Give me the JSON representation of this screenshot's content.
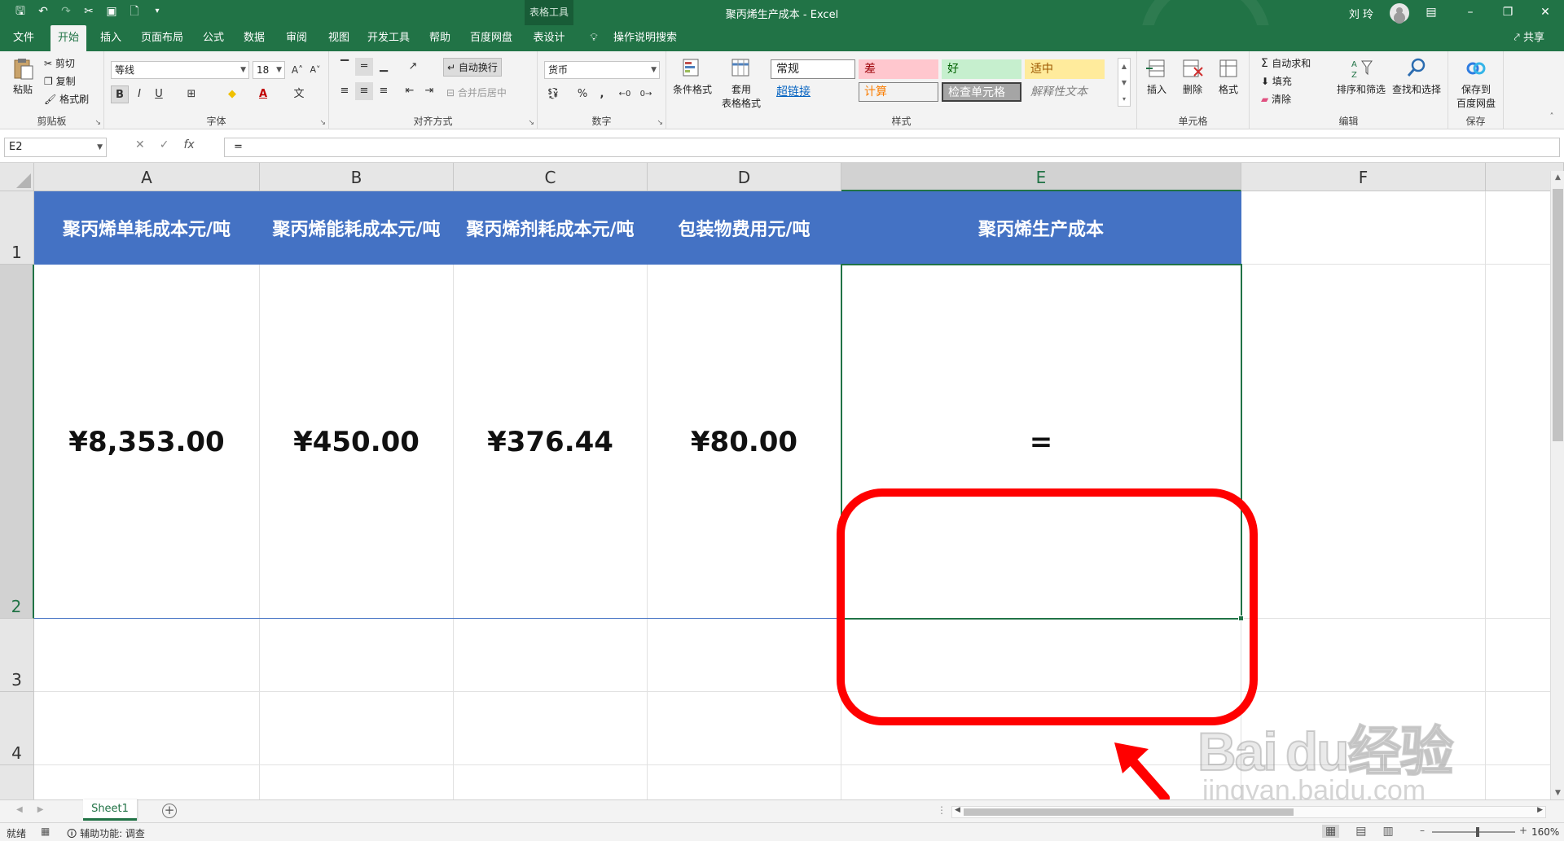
{
  "titlebar": {
    "doc_title": "聚丙烯生产成本  -  Excel",
    "context_tab": "表格工具",
    "user": "刘 玲",
    "qat": {
      "save": "save-icon",
      "undo": "undo-icon",
      "redo": "redo-icon",
      "cut": "cut-icon",
      "new": "new-file-icon",
      "customize": "qat-customize-icon"
    }
  },
  "tabs": [
    {
      "label": "文件"
    },
    {
      "label": "开始"
    },
    {
      "label": "插入"
    },
    {
      "label": "页面布局"
    },
    {
      "label": "公式"
    },
    {
      "label": "数据"
    },
    {
      "label": "审阅"
    },
    {
      "label": "视图"
    },
    {
      "label": "开发工具"
    },
    {
      "label": "帮助"
    },
    {
      "label": "百度网盘"
    },
    {
      "label": "表设计"
    },
    {
      "label": "操作说明搜索"
    }
  ],
  "share_label": "共享",
  "ribbon": {
    "clipboard": {
      "paste": "粘贴",
      "cut": "剪切",
      "copy": "复制",
      "format_painter": "格式刷",
      "label": "剪贴板"
    },
    "font": {
      "name": "等线",
      "size": "18",
      "label": "字体",
      "bold": "B",
      "italic": "I",
      "underline": "U",
      "font_color_glyph": "A"
    },
    "alignment": {
      "wrap": "自动换行",
      "merge": "合并后居中",
      "label": "对齐方式"
    },
    "number": {
      "format": "货币",
      "percent": "%",
      "comma": ",",
      "label": "数字"
    },
    "styles": {
      "conditional": "条件格式",
      "table_format_1": "套用",
      "table_format_2": "表格格式",
      "cells": [
        "常规",
        "差",
        "好",
        "适中",
        "超链接",
        "计算",
        "检查单元格",
        "解释性文本"
      ],
      "label": "样式"
    },
    "cells": {
      "insert": "插入",
      "delete": "删除",
      "format": "格式",
      "label": "单元格"
    },
    "editing": {
      "autosum": "自动求和",
      "fill": "填充",
      "clear": "清除",
      "sort": "排序和筛选",
      "find": "查找和选择",
      "label": "编辑"
    },
    "save": {
      "line1": "保存到",
      "line2": "百度网盘",
      "label": "保存"
    }
  },
  "formula_bar": {
    "name_box": "E2",
    "formula": "="
  },
  "grid": {
    "columns": [
      "A",
      "B",
      "C",
      "D",
      "E",
      "F"
    ],
    "rows": [
      "1",
      "2",
      "3",
      "4"
    ],
    "headers": [
      "聚丙烯单耗成本元/吨",
      "聚丙烯能耗成本元/吨",
      "聚丙烯剂耗成本元/吨",
      "包装物费用元/吨",
      "聚丙烯生产成本"
    ],
    "values": [
      "¥8,353.00",
      "¥450.00",
      "¥376.44",
      "¥80.00",
      "="
    ],
    "selected_cell": "E2"
  },
  "colors": {
    "excel_green": "#217346",
    "header_blue": "#4472c4",
    "callout_red": "#ff0000"
  },
  "sheets": [
    {
      "name": "Sheet1"
    }
  ],
  "status": {
    "ready": "就绪",
    "accessibility": "辅助功能: 调查",
    "zoom": "160%"
  },
  "watermark": {
    "brand": "Baidu经验",
    "url": "jingyan.baidu.com"
  }
}
